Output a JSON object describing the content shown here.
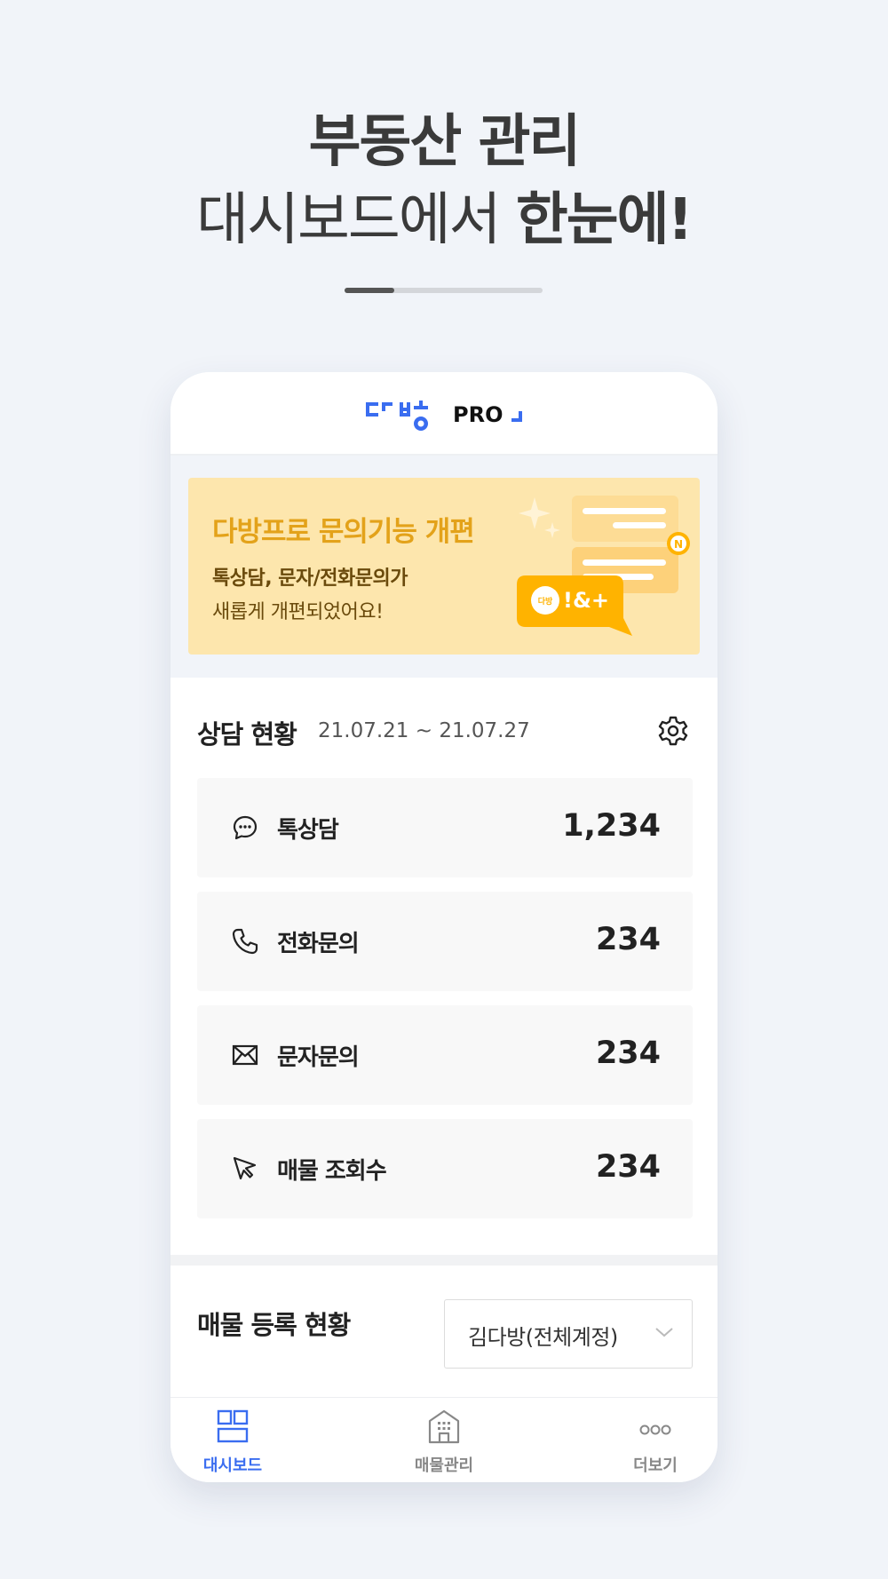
{
  "headline": {
    "line1": "부동산 관리",
    "line2_regular": "대시보드에서 ",
    "line2_bold": "한눈에!"
  },
  "pager": {
    "current": 1,
    "total": 4
  },
  "app": {
    "logo_wordmark": "다방",
    "logo_suffix": "PRO",
    "brand_color": "#3a6df0"
  },
  "banner": {
    "title": "다방프로 문의기능 개편",
    "sub1": "톡상담, 문자/전화문의가",
    "sub2": "새롭게 개편되었어요!",
    "badge": "N",
    "bubble_text": "!&+",
    "bubble_logo": "다방"
  },
  "consult": {
    "title": "상담 현황",
    "range": "21.07.21 ~ 21.07.27",
    "stats": [
      {
        "icon": "chat-bubble-icon",
        "label": "톡상담",
        "value": "1,234"
      },
      {
        "icon": "phone-icon",
        "label": "전화문의",
        "value": "234"
      },
      {
        "icon": "envelope-icon",
        "label": "문자문의",
        "value": "234"
      },
      {
        "icon": "cursor-icon",
        "label": "매물 조회수",
        "value": "234"
      }
    ]
  },
  "registration": {
    "title": "매물 등록 현황",
    "account": "김다방(전체계정)"
  },
  "nav": {
    "items": [
      {
        "label": "대시보드",
        "icon": "dashboard-icon",
        "active": true
      },
      {
        "label": "매물관리",
        "icon": "building-icon",
        "active": false
      },
      {
        "label": "더보기",
        "icon": "more-icon",
        "active": false
      }
    ]
  },
  "colors": {
    "background": "#f1f4f9",
    "accent": "#3a6df0",
    "banner_bg": "#fde6ad",
    "banner_title": "#e3a21a"
  }
}
